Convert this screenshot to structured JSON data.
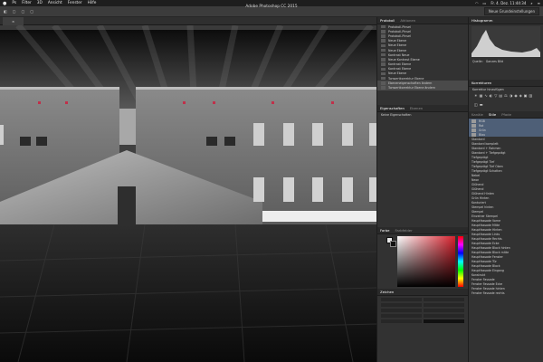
{
  "menubar": {
    "apple": "",
    "items": [
      "Ps",
      "Filter",
      "3D",
      "Ansicht",
      "Fenster",
      "Hilfe"
    ],
    "clock": "Fr. 4. Dez.  11:44:34"
  },
  "window": {
    "title": "Adobe Photoshop CC 2015"
  },
  "options": {
    "workspace": "Neue Grundeinstellungen"
  },
  "panels": {
    "protokoll": {
      "tabs": [
        "Protokoll",
        "Aktionen"
      ],
      "items": [
        "Protokoll-Pinsel",
        "Protokoll-Pinsel",
        "Protokoll-Pinsel",
        "Neue Ebene",
        "Neue Ebene",
        "Neue Ebene",
        "Kontrast Neue",
        "Neue Kontrast Ebene",
        "Kontrast Ebene",
        "Kontrast Ebene",
        "Neue Ebene",
        "Tonwertkorrektur Ebene",
        "Ebeneneigenschaften ändern",
        "Tonwertkorrektur Ebene ändern"
      ]
    },
    "eigenschaften": {
      "tabs": [
        "Eigenschaften",
        "Ebenen"
      ],
      "subtitle": "Keine Eigenschaften"
    },
    "farbe": {
      "tabs": [
        "Farbe",
        "Farbfelder"
      ]
    },
    "zeichen": {
      "tabs": [
        "Zeichen"
      ]
    },
    "histogramm": {
      "tabs": [
        "Histogramm"
      ],
      "labels": [
        "Quelle:",
        "Ganzes Bild"
      ]
    },
    "korrekturen": {
      "tabs": [
        "Korrekturen"
      ],
      "label": "Korrektur hinzufügen"
    },
    "stile": {
      "tabs": [
        "Kanäle",
        "Stile",
        "Pfade"
      ],
      "items": [
        "RGB",
        "Rot",
        "Grün",
        "Blau",
        "Standard",
        "Standard komplett",
        "Standard + Rahmen",
        "Standard + Tiefgeprägt",
        "Tiefgeprägt",
        "Tiefgeprägt Tief",
        "Tiefgeprägt Tief Oben",
        "Tiefgeprägt Schatten",
        "Nebel",
        "Neon",
        "Glühend",
        "Glühend",
        "Glühend Hinten",
        "Grün Hinten",
        "Konturiert",
        "Stempel hinten",
        "Stempel",
        "Einzelner Stempel",
        "Hauptfassade Vorne",
        "Hauptfassade Mitte",
        "Hauptfassade Hinten",
        "Hauptfassade Links",
        "Hauptfassade Rechts",
        "Hauptfassade Ecke",
        "Hauptfassade Block hinten",
        "Hauptfassade Block mitte",
        "Hauptfassade Fenster",
        "Hauptfassade Tür",
        "Hauptfassade Block",
        "Hauptfassade Eingang",
        "Konstrukt",
        "Fenster Fassade",
        "Fenster Fassade Ecke",
        "Fenster Fassade hinten",
        "Fenster Fassade rechts"
      ]
    }
  },
  "status": {
    "zoom": ""
  }
}
